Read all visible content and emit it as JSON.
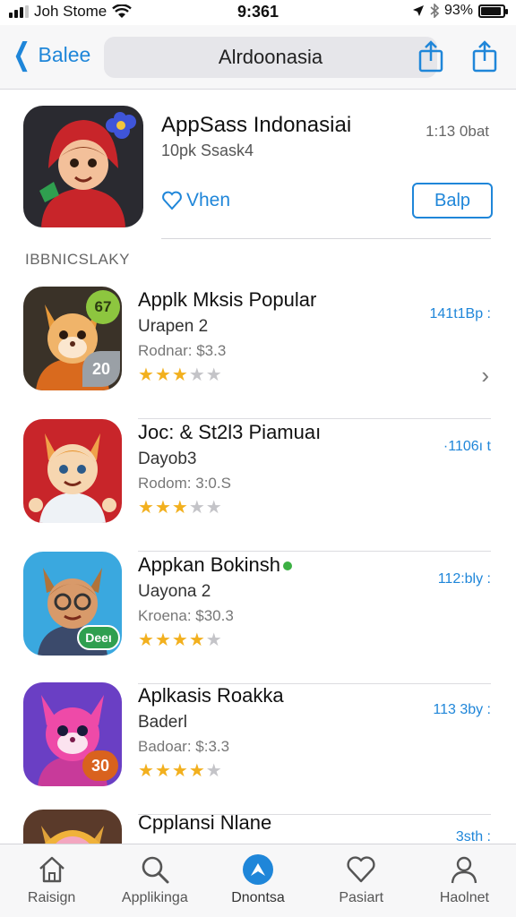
{
  "status_bar": {
    "carrier": "Joh Stome",
    "time": "9:361",
    "battery": "93%",
    "battery_level": 0.93
  },
  "nav": {
    "back_label": "Balee",
    "title": "Alrdoonasia"
  },
  "featured": {
    "title": "AppSass Indonasiai",
    "subtitle": "10pk Ssask4",
    "time": "1:13 0bat",
    "wish_label": "Vhen",
    "get_label": "Balp"
  },
  "section_label": "IBBNICSLAKY",
  "apps": [
    {
      "name": "Applk Mksis Popular",
      "developer": "Urapen 2",
      "price": "Rodnar: $3.3",
      "size": "141t1Bp :",
      "rating": 3,
      "badge_top": "67",
      "badge_bottom": "20"
    },
    {
      "name": "Joc: & St2l3 Piamuaı",
      "developer": "Dayob3",
      "price": "Rodom: 3:0.S",
      "size": "·1106ı t",
      "rating": 3
    },
    {
      "name": "Appkan Bokinsh",
      "developer": "Uayona 2",
      "price": "Kroena: $30.3",
      "size": "112:bly :",
      "rating": 4,
      "badge_bottom": "Deeı"
    },
    {
      "name": "Aplkasis Roakka",
      "developer": "Baderl",
      "price": "Badoar: $:3.3",
      "size": "113 3by :",
      "rating": 4,
      "badge_bottom": "30"
    },
    {
      "name": "Cpplansi Nlane",
      "developer": "",
      "price": "",
      "size": "3sth :",
      "rating": 0
    }
  ],
  "tabs": [
    {
      "label": "Raisign",
      "icon": "home-icon"
    },
    {
      "label": "Applikinga",
      "icon": "search-icon"
    },
    {
      "label": "Dnontsa",
      "icon": "featured-icon"
    },
    {
      "label": "Pasiart",
      "icon": "heart-icon"
    },
    {
      "label": "Haolnet",
      "icon": "person-icon"
    }
  ],
  "colors": {
    "accent": "#1f86d9",
    "star": "#f2b01e"
  }
}
